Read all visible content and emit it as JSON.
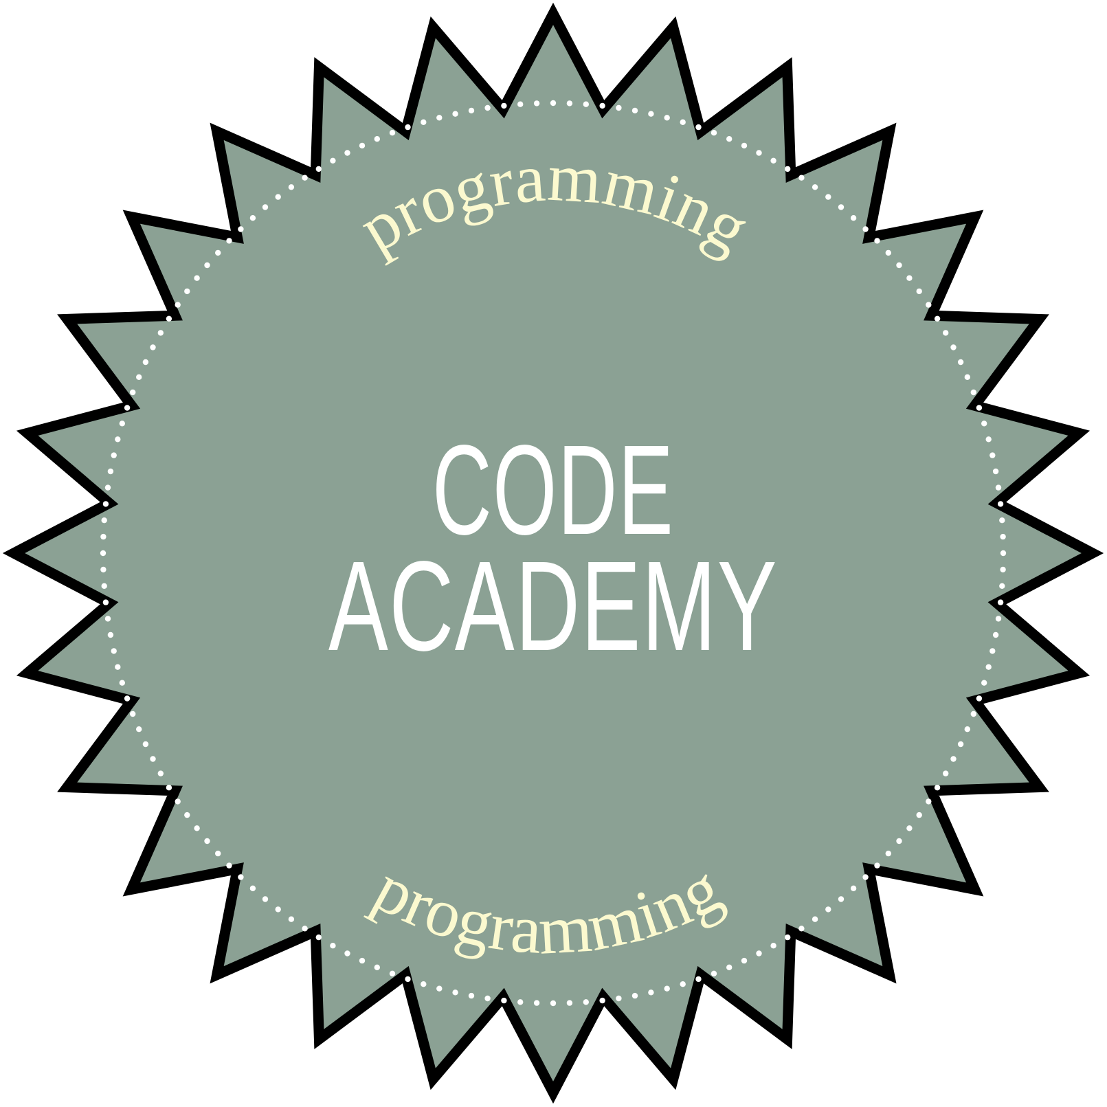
{
  "badge": {
    "top_arc_text": "programming",
    "bottom_arc_text": "programming",
    "title_line_1": "CODE",
    "title_line_2": "ACADEMY"
  },
  "colors": {
    "fill": "#8BA194",
    "outline": "#000000",
    "title_text": "#FFFFFF",
    "arc_text": "#FBF9CF",
    "dots": "#FFFFFF",
    "background": "#FFFFFF"
  },
  "shape": {
    "type": "starburst-seal",
    "points": 28
  }
}
